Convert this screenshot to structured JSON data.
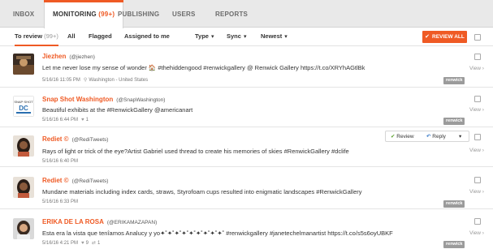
{
  "topnav": {
    "tabs": [
      {
        "label": "INBOX"
      },
      {
        "label": "MONITORING",
        "count": "(99+)"
      },
      {
        "label": "PUBLISHING"
      },
      {
        "label": "USERS"
      },
      {
        "label": "REPORTS"
      }
    ]
  },
  "subnav": {
    "to_review": "To review",
    "to_review_count": "(99+)",
    "all": "All",
    "flagged": "Flagged",
    "assigned": "Assigned to me",
    "type": "Type",
    "sync": "Sync",
    "newest": "Newest",
    "review_all": "REVIEW ALL"
  },
  "posts": [
    {
      "name": "Jiezhen",
      "handle": "(@jiezhen)",
      "text": "Let me never lose my sense of wonder 🏠 #thehiddengood #renwickgallery @ Renwick Gallery https://t.co/XRYhAGtlBk",
      "date": "5/16/16 11:05 PM",
      "location": "Washington - United States",
      "likes": "",
      "retweets": "",
      "tag": "renwick",
      "view": "View"
    },
    {
      "name": "Snap Shot Washington",
      "handle": "(@SnapWashington)",
      "text": "Beautiful exhibits at the #RenwickGallery @americanart",
      "date": "5/16/16 6:44 PM",
      "location": "",
      "likes": "1",
      "retweets": "",
      "tag": "renwick",
      "view": "View"
    },
    {
      "name": "Rediet ©",
      "handle": "(@RediTweets)",
      "text": "Rays of light or trick of the eye?Artist Gabriel used thread to create his memories of skies #RenwickGallery #dclife",
      "date": "5/16/16 6:40 PM",
      "location": "",
      "likes": "",
      "retweets": "",
      "tag": "",
      "view": "View",
      "actions": {
        "review": "Review",
        "reply": "Reply"
      }
    },
    {
      "name": "Rediet ©",
      "handle": "(@RediTweets)",
      "text": "Mundane materials including index cards, straws, Styrofoam cups resulted into enigmatic landscapes #RenwickGallery",
      "date": "5/16/16 6:33 PM",
      "location": "",
      "likes": "",
      "retweets": "",
      "tag": "renwick",
      "view": "View"
    },
    {
      "name": "ERIKA DE LA ROSA",
      "handle": "(@ERIKAMAZAPAN)",
      "text": "Esta era la vista que tenîamos Analucy y yo✦˚✦˚✦˚✦˚✦˚✦˚✦˚✦˚✦˚ #renwickgallery #janetechelmanartist https://t.co/s5s6oyUBKF",
      "date": "5/16/16 4:21 PM",
      "location": "",
      "likes": "9",
      "retweets": "1",
      "tag": "renwick",
      "view": "View"
    }
  ],
  "colors": {
    "accent": "#ef5a24",
    "tag": "#9b9b9b",
    "review_ok": "#5aa02c",
    "reply": "#3a7bc8"
  }
}
